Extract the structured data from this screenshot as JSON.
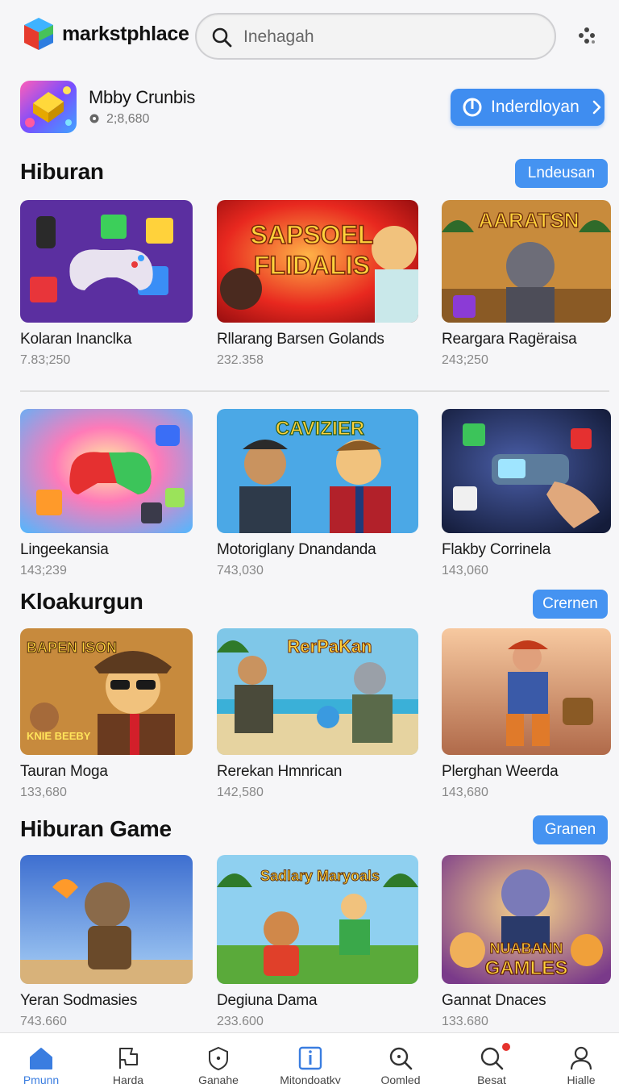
{
  "header": {
    "brand": "markstphlace",
    "search_placeholder": "Inehagah"
  },
  "profile": {
    "name": "Mbby Crunbis",
    "count": "2;8,680",
    "button_label": "Inderdloyan"
  },
  "sections": [
    {
      "title": "Hiburan",
      "button": "Lndeusan",
      "cards": [
        {
          "title": "Kolaran Inanclka",
          "count": "7.83;250"
        },
        {
          "title": "Rllarang Barsen Golands",
          "count": "232.358"
        },
        {
          "title": "Reargara Ragёraisa",
          "count": "243;250"
        }
      ]
    },
    {
      "title": "",
      "button": "",
      "cards": [
        {
          "title": "Lingeekansia",
          "count": "143;239"
        },
        {
          "title": "Motoriglany Dnandanda",
          "count": "743,030"
        },
        {
          "title": "Flakby Corrinela",
          "count": "143,060"
        }
      ]
    },
    {
      "title": "Kloakurgun",
      "button": "Crernen",
      "cards": [
        {
          "title": "Tauran Moga",
          "count": "133,680"
        },
        {
          "title": "Rerekan Hmnrican",
          "count": "142,580"
        },
        {
          "title": "Plerghan Weerda",
          "count": "143,680"
        }
      ]
    },
    {
      "title": "Hiburan Game",
      "button": "Granen",
      "cards": [
        {
          "title": "Yeran Sodmasies",
          "count": "743.660"
        },
        {
          "title": "Degiuna Dama",
          "count": "233.600"
        },
        {
          "title": "Gannat Dnaces",
          "count": "133.680"
        }
      ]
    }
  ],
  "thumb_text": {
    "c1_2_line1": "SAPSOEL",
    "c1_2_line2": "FLIDALIS",
    "c1_3": "AARATSN",
    "c2_2": "CAVIZIER",
    "c3_1_top": "BAPEN ISON",
    "c3_1_bottom": "KNIE BEEBY",
    "c3_2": "RerPaKan",
    "c4_2": "Sadlary Maryoals",
    "c4_3_line1": "NUABANN",
    "c4_3_line2": "GAMLES"
  },
  "nav": [
    {
      "label": "Pmunn",
      "icon": "home-icon",
      "active": true
    },
    {
      "label": "Harda",
      "icon": "flag-icon",
      "active": false
    },
    {
      "label": "Ganahe",
      "icon": "shield-icon",
      "active": false
    },
    {
      "label": "Mitondoatky",
      "icon": "info-icon",
      "active": false
    },
    {
      "label": "Oomled",
      "icon": "search-icon",
      "active": false
    },
    {
      "label": "Besat",
      "icon": "notification-search-icon",
      "active": false
    },
    {
      "label": "Hjalle",
      "icon": "profile-icon",
      "active": false
    }
  ],
  "colors": {
    "accent": "#4593f1",
    "active_nav": "#3a7de0",
    "badge": "#e5322d"
  }
}
